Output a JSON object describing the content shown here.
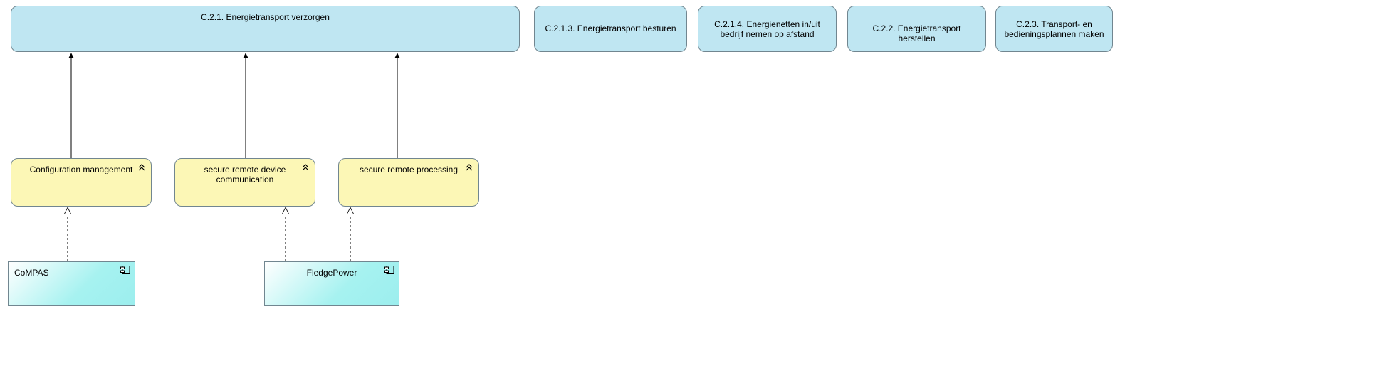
{
  "nodes": {
    "c21": "C.2.1. Energietransport verzorgen",
    "c213": "C.2.1.3. Energietransport besturen",
    "c214": "C.2.1.4. Energienetten in/uit bedrijf nemen op afstand",
    "c222": "C.2.2. Energietransport herstellen",
    "c223": "C.2.3. Transport- en bedieningsplannen maken",
    "configMgmt": "Configuration management",
    "secureComm": "secure remote device communication",
    "secureProc": "secure remote processing",
    "compas": "CoMPAS",
    "fledge": "FledgePower"
  }
}
